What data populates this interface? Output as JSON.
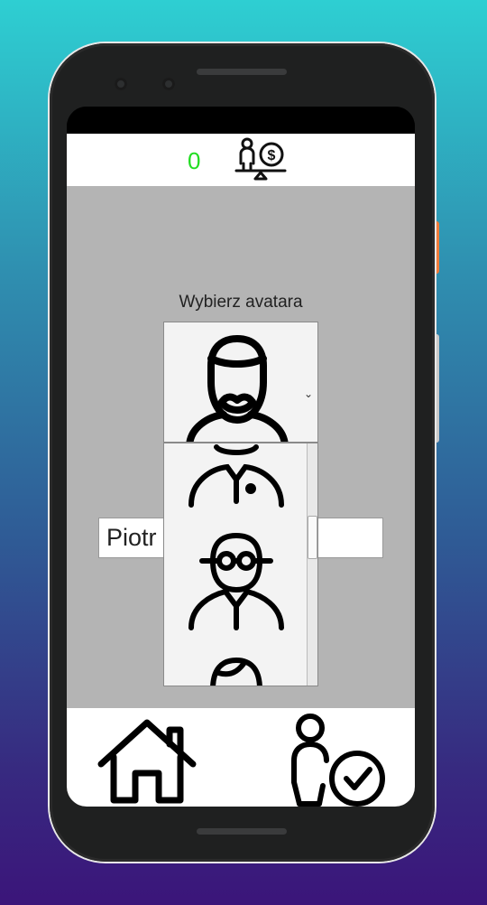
{
  "topbar": {
    "counter": "0",
    "icon": "balance-money-icon",
    "counter_color": "#22dd22"
  },
  "avatar": {
    "title": "Wybierz avatara",
    "selected_icon": "bearded-man-avatar-icon",
    "options": [
      "man-with-tie-avatar-icon",
      "man-with-glasses-avatar-icon",
      "woman-avatar-icon"
    ]
  },
  "name_input": {
    "value": "Piotr"
  },
  "bottom_nav": {
    "home_icon": "home-icon",
    "profile_icon": "user-check-icon"
  }
}
